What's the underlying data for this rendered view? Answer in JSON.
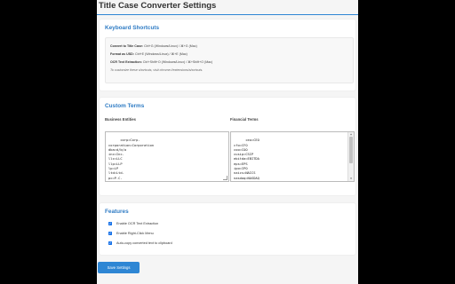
{
  "page": {
    "title": "Title Case Converter Settings"
  },
  "keyboard_shortcuts": {
    "title": "Keyboard Shortcuts",
    "items": [
      {
        "label": "Convert to Title Case:",
        "value": "Ctrl+G (Windows/Linux) / ⌘+G (Mac)"
      },
      {
        "label": "Format as USD:",
        "value": "Ctrl+E (Windows/Linux) / ⌘+E (Mac)"
      },
      {
        "label": "OCR Text Extraction:",
        "value": "Ctrl+Shift+O (Windows/Linux) / ⌘+Shift+O (Mac)"
      }
    ],
    "note": "To customize these shortcuts, visit chrome://extensions/shortcuts."
  },
  "custom_terms": {
    "title": "Custom Terms",
    "business_entities": {
      "label": "Business Entities",
      "value": "corp=Corp.\ncorporation=Corporation\ndba=d/b/a\ninc=Inc.\nllc=LLC\nllp=LLP\nlp=LP\nltd=Ltd.\npc=P.C.\npllc=PLLC"
    },
    "financial_terms": {
      "label": "Financial Terms",
      "value": "ceo=CEO\ncfo=CFO\ncoo=COO\ncusip=CSIP\nebitda=EBITDA\neps=EPS\nipo=IPO\nnaics=NAICS\nnasdaq=NASDAQ\nnyse=NYSE\nroi=ROI"
    }
  },
  "features": {
    "title": "Features",
    "items": [
      {
        "label": "Enable OCR Text Extraction",
        "checked": true
      },
      {
        "label": "Enable Right-Click Menu",
        "checked": true
      },
      {
        "label": "Auto-copy converted text to clipboard",
        "checked": true
      }
    ]
  },
  "save_button": {
    "label": "Save Settings"
  },
  "colors": {
    "accent": "#2e86d4",
    "heading": "#2e7bc4",
    "checkbox": "#1a73e8"
  }
}
